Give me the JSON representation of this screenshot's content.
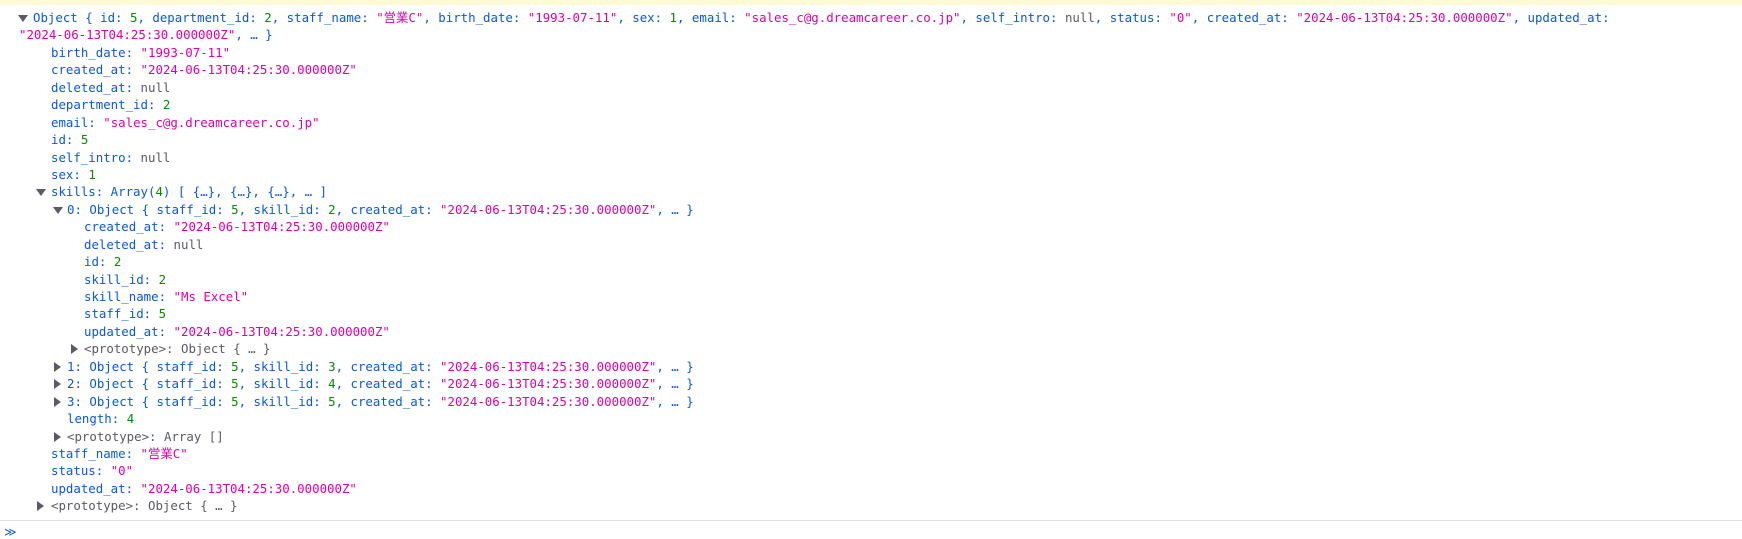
{
  "rows": [
    "Object { id: 5, department_id: 2, staff_name: \"営業C\", birth_date: \"1993-07-11\", sex: 1, email: \"sales_c@g.dreamcareer.co.jp\", self_intro: null, status: \"0\", created_at: \"2024-06-13T04:25:30.000000Z\", updated_at:",
    "\"2024-06-13T04:25:30.000000Z\", … }",
    "birth_date: \"1993-07-11\"",
    "created_at: \"2024-06-13T04:25:30.000000Z\"",
    "deleted_at: null",
    "department_id: 2",
    "email: \"sales_c@g.dreamcareer.co.jp\"",
    "id: 5",
    "self_intro: null",
    "sex: 1",
    "skills: Array(4) [ {…}, {…}, {…}, … ]",
    "0: Object { staff_id: 5, skill_id: 2, created_at: \"2024-06-13T04:25:30.000000Z\", … }",
    "created_at: \"2024-06-13T04:25:30.000000Z\"",
    "deleted_at: null",
    "id: 2",
    "skill_id: 2",
    "skill_name: \"Ms Excel\"",
    "staff_id: 5",
    "updated_at: \"2024-06-13T04:25:30.000000Z\"",
    "<prototype>: Object { … }",
    "1: Object { staff_id: 5, skill_id: 3, created_at: \"2024-06-13T04:25:30.000000Z\", … }",
    "2: Object { staff_id: 5, skill_id: 4, created_at: \"2024-06-13T04:25:30.000000Z\", … }",
    "3: Object { staff_id: 5, skill_id: 5, created_at: \"2024-06-13T04:25:30.000000Z\", … }",
    "length: 4",
    "<prototype>: Array []",
    "staff_name: \"営業C\"",
    "status: \"0\"",
    "updated_at: \"2024-06-13T04:25:30.000000Z\"",
    "<prototype>: Object { … }"
  ],
  "prompt": "≫"
}
